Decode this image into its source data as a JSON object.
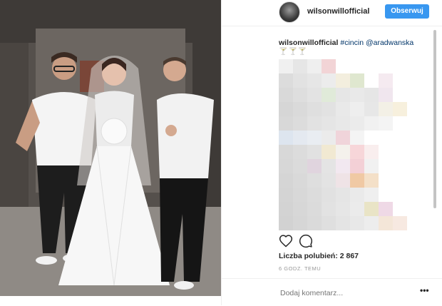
{
  "post": {
    "username": "wilsonwillofficial",
    "follow_label": "Obserwuj",
    "caption": {
      "user": "wilsonwillofficial",
      "tag1": "#cincin",
      "tag2": "@aradwanska",
      "emoji": "🍸🍸🍸"
    },
    "likes_label": "Liczba polubień: 2 867",
    "time_label": "6 GODZ. TEMU",
    "comment_placeholder": "Dodaj komentarz...",
    "more_label": "•••"
  },
  "colors": {
    "accent": "#3897f0",
    "text": "#262626",
    "muted": "#999999",
    "border": "#efefef"
  },
  "icons": [
    "heart-icon",
    "comment-icon",
    "more-icon"
  ],
  "mosaic_colors": [
    "#f0f0f0",
    "#e6e6e6",
    "#efefef",
    "#f2d4d6",
    "#ffffff",
    "#ffffff",
    "#ffffff",
    "#ffffff",
    "#ffffff",
    "#ffffff",
    "#dcdcdc",
    "#e2e2e2",
    "#e6e6e6",
    "#ececec",
    "#f3eede",
    "#dfe7cf",
    "#ffffff",
    "#f5eaf0",
    "#ffffff",
    "#ffffff",
    "#d9d9d9",
    "#dedede",
    "#e3e3e3",
    "#e0ead9",
    "#e6e6e6",
    "#e9e9e9",
    "#e6e6e6",
    "#f0e6ee",
    "#ffffff",
    "#ffffff",
    "#d6d6d6",
    "#dadada",
    "#dfdfdf",
    "#e2e2e2",
    "#e9e9e9",
    "#eeeeee",
    "#e7e7e7",
    "#f3f0e6",
    "#f7f0dd",
    "#ffffff",
    "#d8d8d8",
    "#dcdcdc",
    "#e2e2e2",
    "#e5e5e5",
    "#e8e8e8",
    "#ebebeb",
    "#f1f1f1",
    "#f4f4f4",
    "#ffffff",
    "#ffffff",
    "#dde5ef",
    "#e4e9f0",
    "#e9edf2",
    "#ebebeb",
    "#f0d4da",
    "#f4f4f4",
    "#ffffff",
    "#ffffff",
    "#ffffff",
    "#ffffff",
    "#d8d8d8",
    "#dcdcdc",
    "#e1e1e1",
    "#f1e9d2",
    "#f4f1ec",
    "#f7d6d9",
    "#f9eeee",
    "#ffffff",
    "#ffffff",
    "#ffffff",
    "#d7d7d7",
    "#dbdbdb",
    "#e0d4de",
    "#e4e4e4",
    "#f2e8f0",
    "#f3d0d6",
    "#f1f1f1",
    "#ffffff",
    "#ffffff",
    "#ffffff",
    "#d5d5d5",
    "#d9d9d9",
    "#dedede",
    "#e3e3e3",
    "#efe3e6",
    "#f0c9a4",
    "#f4e0c8",
    "#ffffff",
    "#ffffff",
    "#ffffff",
    "#d4d4d4",
    "#d8d8d8",
    "#dcdcdc",
    "#e1e1e1",
    "#e5e5e5",
    "#eaeaea",
    "#efefef",
    "#ffffff",
    "#ffffff",
    "#ffffff",
    "#d3d3d3",
    "#d7d7d7",
    "#dbdbdb",
    "#e2e2e2",
    "#e6e6e6",
    "#ebebeb",
    "#e9e4c6",
    "#efd9e6",
    "#ffffff",
    "#ffffff",
    "#d2d2d2",
    "#d6d6d6",
    "#dadada",
    "#dfdfdf",
    "#e4e4e4",
    "#e8e8e8",
    "#ededed",
    "#f4e6d8",
    "#f7e9e1",
    "#ffffff"
  ]
}
